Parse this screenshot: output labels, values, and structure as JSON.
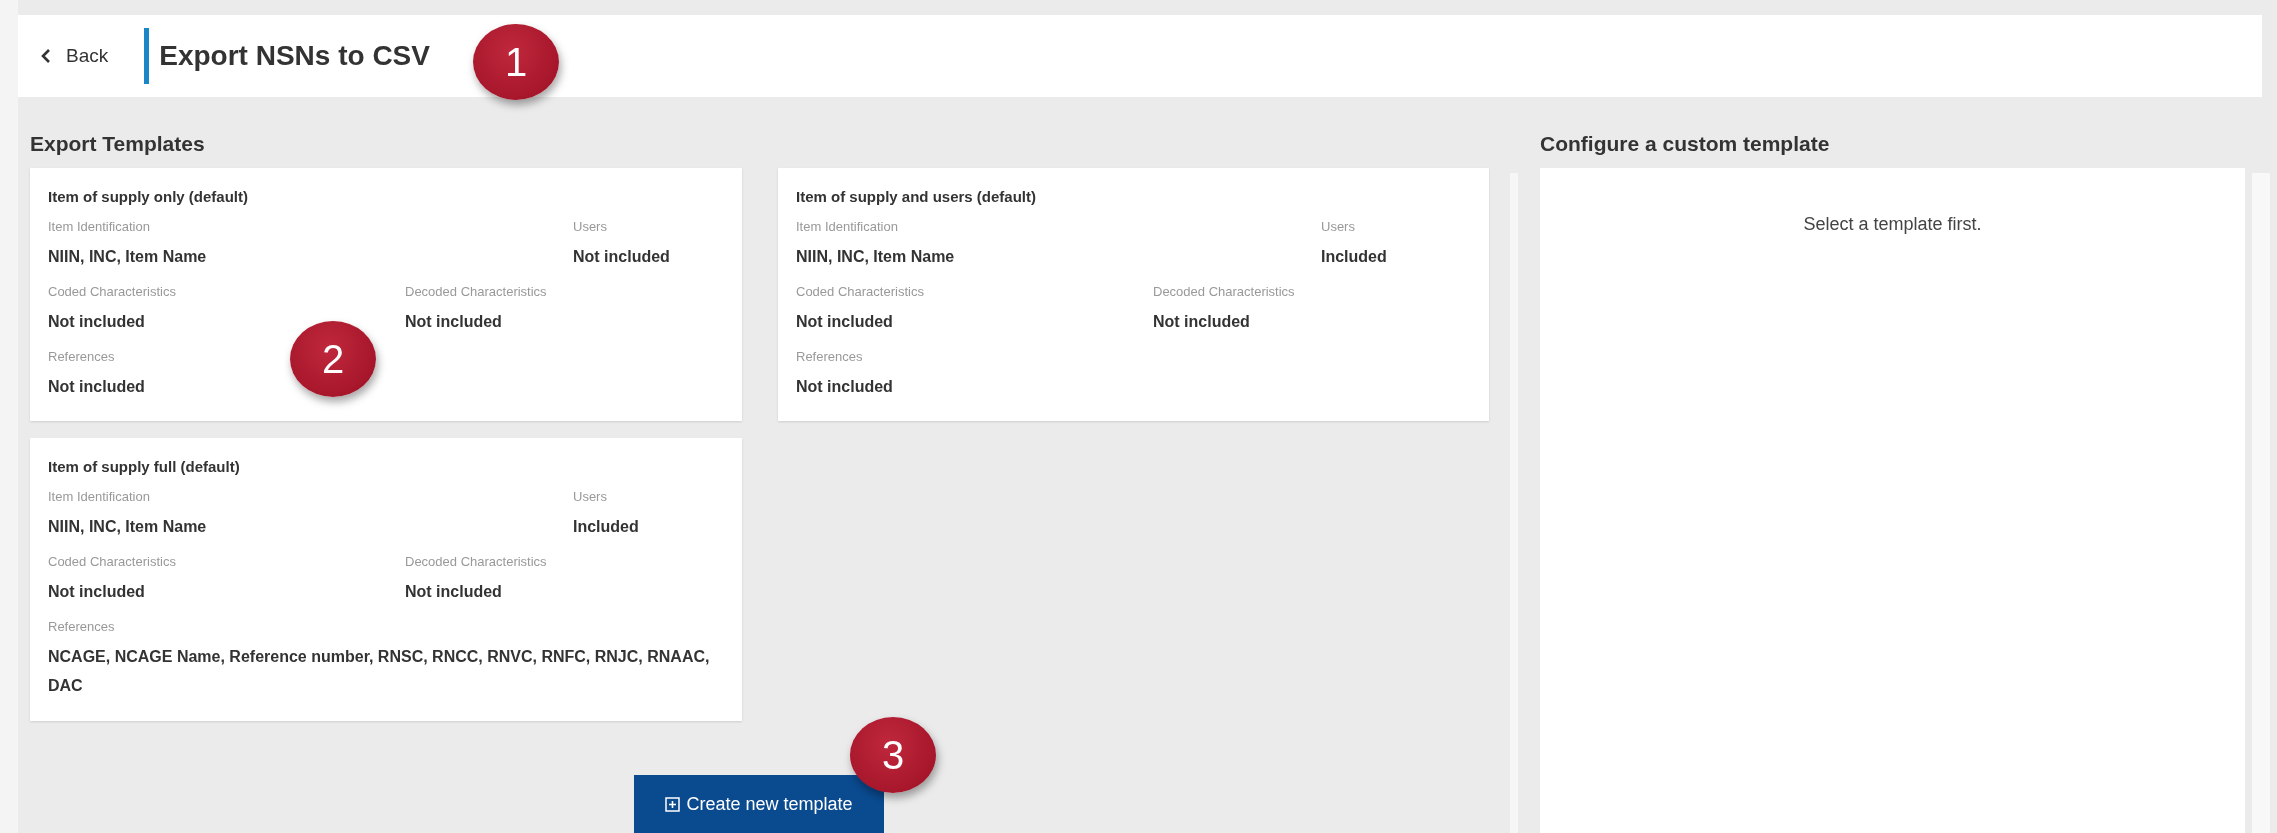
{
  "header": {
    "back_label": "Back",
    "title": "Export NSNs to CSV"
  },
  "templates": {
    "heading": "Export Templates",
    "cards": [
      {
        "title": "Item of supply only (default)",
        "fields": [
          {
            "label": "Item Identification",
            "value": "NIIN, INC, Item Name"
          },
          {
            "label": "Users",
            "value": "Not included"
          },
          {
            "label": "Coded Characteristics",
            "value": "Not included"
          },
          {
            "label": "Decoded Characteristics",
            "value": "Not included"
          },
          {
            "label": "References",
            "value": "Not included"
          }
        ]
      },
      {
        "title": "Item of supply and users (default)",
        "fields": [
          {
            "label": "Item Identification",
            "value": "NIIN, INC, Item Name"
          },
          {
            "label": "Users",
            "value": "Included"
          },
          {
            "label": "Coded Characteristics",
            "value": "Not included"
          },
          {
            "label": "Decoded Characteristics",
            "value": "Not included"
          },
          {
            "label": "References",
            "value": "Not included"
          }
        ]
      },
      {
        "title": "Item of supply full (default)",
        "fields": [
          {
            "label": "Item Identification",
            "value": "NIIN, INC, Item Name"
          },
          {
            "label": "Users",
            "value": "Included"
          },
          {
            "label": "Coded Characteristics",
            "value": "Not included"
          },
          {
            "label": "Decoded Characteristics",
            "value": "Not included"
          },
          {
            "label": "References",
            "value": "NCAGE, NCAGE Name, Reference number, RNSC, RNCC, RNVC, RNFC, RNJC, RNAAC, DAC"
          }
        ]
      }
    ],
    "create_button": "Create new template"
  },
  "configure": {
    "heading": "Configure a custom template",
    "message": "Select a template first."
  },
  "callouts": [
    "1",
    "2",
    "3"
  ]
}
